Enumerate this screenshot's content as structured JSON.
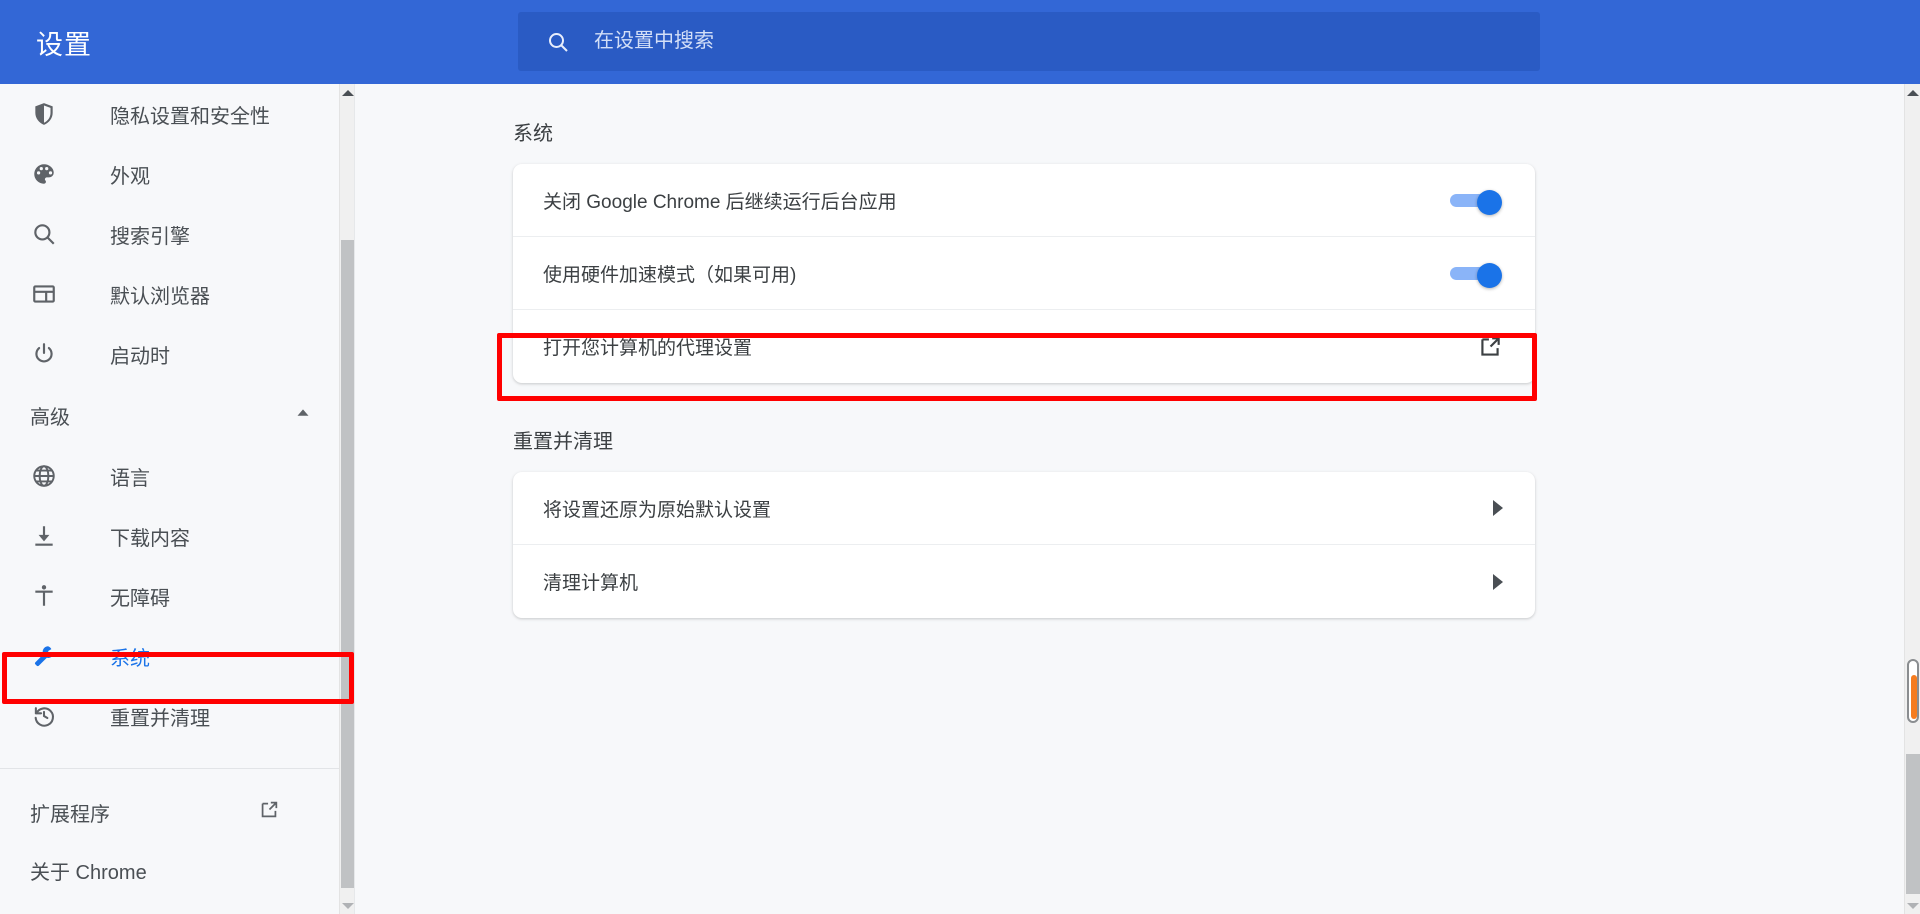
{
  "header": {
    "title": "设置",
    "search": {
      "placeholder": "在设置中搜索",
      "value": "",
      "icon": "search-icon"
    },
    "bar_color": "#3367d6",
    "search_bg": "#2a5bc4"
  },
  "sidebar": {
    "items": [
      {
        "label": "隐私设置和安全性",
        "icon": "shield-icon",
        "selected": false
      },
      {
        "label": "外观",
        "icon": "palette-icon",
        "selected": false
      },
      {
        "label": "搜索引擎",
        "icon": "search-icon",
        "selected": false
      },
      {
        "label": "默认浏览器",
        "icon": "browser-window-icon",
        "selected": false
      },
      {
        "label": "启动时",
        "icon": "power-icon",
        "selected": false
      }
    ],
    "advanced_section": {
      "label": "高级",
      "expanded": true,
      "caret_icon": "chevron-up-icon"
    },
    "advanced_items": [
      {
        "label": "语言",
        "icon": "globe-icon",
        "selected": false
      },
      {
        "label": "下载内容",
        "icon": "download-icon",
        "selected": false
      },
      {
        "label": "无障碍",
        "icon": "accessibility-icon",
        "selected": false
      },
      {
        "label": "系统",
        "icon": "wrench-icon",
        "selected": true
      },
      {
        "label": "重置并清理",
        "icon": "history-restore-icon",
        "selected": false
      }
    ],
    "footer_items": [
      {
        "label": "扩展程序",
        "external": true,
        "external_icon": "external-link-icon"
      },
      {
        "label": "关于 Chrome",
        "external": false,
        "external_icon": ""
      }
    ],
    "selected_color": "#1a73e8",
    "scrollbar": {
      "icon_up": "scroll-up-arrow-icon",
      "icon_down": "scroll-down-arrow-icon"
    }
  },
  "main": {
    "sections": [
      {
        "title": "系统",
        "rows": [
          {
            "label": "关闭 Google Chrome 后继续运行后台应用",
            "control": "toggle",
            "toggle_on": true,
            "icon": ""
          },
          {
            "label": "使用硬件加速模式（如果可用)",
            "control": "toggle",
            "toggle_on": true,
            "icon": ""
          },
          {
            "label": "打开您计算机的代理设置",
            "control": "external",
            "toggle_on": false,
            "icon": "external-link-icon",
            "highlighted": true
          }
        ]
      },
      {
        "title": "重置并清理",
        "rows": [
          {
            "label": "将设置还原为原始默认设置",
            "control": "caret",
            "toggle_on": false,
            "icon": "caret-right-icon"
          },
          {
            "label": "清理计算机",
            "control": "caret",
            "toggle_on": false,
            "icon": "caret-right-icon"
          }
        ]
      }
    ]
  },
  "annotations": {
    "color": "#ff0000",
    "boxes": [
      {
        "target": "sidebar-item-system"
      },
      {
        "target": "row-proxy-settings"
      }
    ]
  },
  "page_scrollbar": {
    "gauge_color": "#f57c20",
    "thumb_color": "#c0c2c4"
  }
}
